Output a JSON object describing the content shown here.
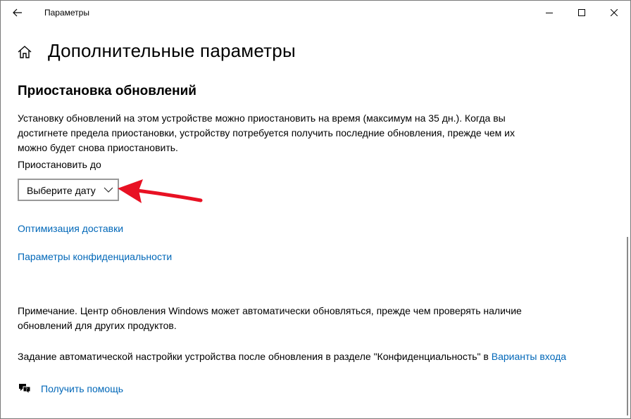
{
  "window": {
    "title": "Параметры",
    "back_icon": "arrow-left-icon",
    "controls": [
      "minimize-icon",
      "maximize-icon",
      "close-icon"
    ]
  },
  "page": {
    "home_icon": "home-icon",
    "title": "Дополнительные параметры"
  },
  "pause_section": {
    "heading": "Приостановка обновлений",
    "description_line1": "Установку обновлений на этом устройстве можно приостановить на время (максимум на 35 дн.). Когда вы",
    "description_line2": "достигнете предела приостановки, устройству потребуется получить последние обновления, прежде чем их",
    "description_line3": "можно будет снова приостановить.",
    "pause_until_label": "Приостановить до",
    "date_select_value": "Выберите дату"
  },
  "links": {
    "delivery_optimization": "Оптимизация доставки",
    "privacy_settings": "Параметры конфиденциальности"
  },
  "note": {
    "line1": "Примечание. Центр обновления Windows может автоматически обновляться, прежде чем проверять наличие",
    "line2": "обновлений для других продуктов."
  },
  "auto_setup": {
    "text": "Задание автоматической настройки устройства после обновления в разделе \"Конфиденциальность\" в ",
    "link": "Варианты входа"
  },
  "help": {
    "icon": "chat-help-icon",
    "label": "Получить помощь"
  },
  "colors": {
    "link": "#0067b8",
    "annotation_arrow": "#e81123"
  }
}
